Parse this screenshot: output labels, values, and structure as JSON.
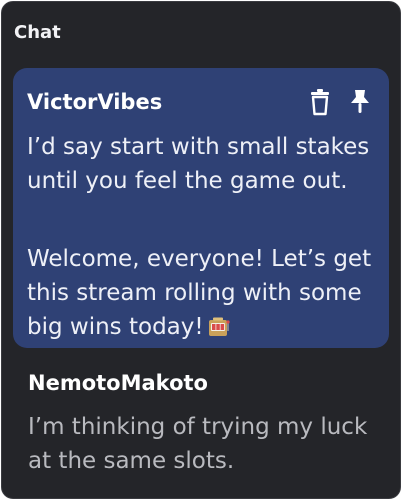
{
  "chat": {
    "title": "Chat",
    "messages": [
      {
        "author": "VictorVibes",
        "highlighted": true,
        "actions": [
          "trash-icon",
          "pin-icon"
        ],
        "lines": [
          "I’d say start with small stakes until you feel the game out.",
          "Welcome, everyone! Let’s get this stream rolling with some big wins today!"
        ],
        "emoji": "slot-machine-icon"
      },
      {
        "author": "NemotoMakoto",
        "highlighted": false,
        "lines": [
          "I’m thinking of trying my luck at the same slots."
        ]
      }
    ]
  },
  "colors": {
    "panel_bg": "#242529",
    "highlight_bg": "#2f4175",
    "text_primary": "#ffffff",
    "text_muted": "#b9babf"
  }
}
